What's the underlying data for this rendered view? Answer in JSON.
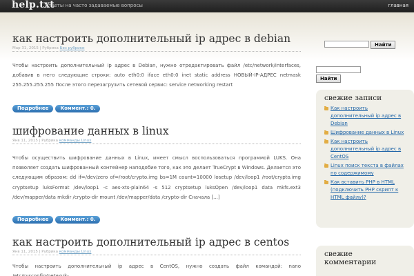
{
  "header": {
    "logo": "help.txt",
    "tagline": "ответы на часто задаваемые вопросы",
    "nav_home": "главная"
  },
  "posts": [
    {
      "title": "как настроить дополнительный ip адрес в debian",
      "date": "Мар 31, 2015",
      "sep": " | Рубрика ",
      "category": "Без рубрики",
      "body": "Чтобы настроить дополнительный ip адрес в Debian, нужно отредактировать файл /etc/network/interfaces, добавив в него следующие строки: auto eth0:0 iface eth0:0 inet static address НОВЫЙ-IP-АДРЕС netmask 255.255.255.255 После этого перезагрузить сетевой сервис: service networking restart",
      "more_label": "Подробнее",
      "comments_label": "Коммент.: 0."
    },
    {
      "title": "шифрование данных в linux",
      "date": "Янв 11, 2015",
      "sep": " | Рубрика ",
      "category": "комманды Linux",
      "body": "Чтобы осуществить шифрование данных в Linux, имеет смысл воспользоваться программой LUKS. Она позволяет создать шифрованный контейнер наподобие того, как это делает TrueCrypt в Windows. Делается это следующим образом: dd if=/dev/zero of=/root/crypto.img bs=1M count=10000 losetup /dev/loop1 /root/crypto.img cryptsetup luksFormat /dev/loop1 -c aes-xts-plain64 -s 512 cryptsetup luksOpen /dev/loop1 data mkfs.ext3 /dev/mapper/data mkdir /crypto-dir mount /dev/mapper/data /crypto-dir Сначала [...]",
      "more_label": "Подробнее",
      "comments_label": "Коммент.: 0."
    },
    {
      "title": "как настроить дополнительный ip адрес в centos",
      "date": "Янв 11, 2015",
      "sep": " | Рубрика ",
      "category": "комманды Linux",
      "body": "Чтобы настроить дополнительный ip адрес в CentOS, нужно создать файл командой: nano /etc/sysconfig/network-"
    }
  ],
  "sidebar": {
    "search_button": "Найти",
    "recent_title": "свежие записи",
    "recent_items": [
      "Как настроить дополнительный ip адрес в Debian",
      "Шифрование данных в Linux",
      "Как настроить дополнительный ip адрес в CentOS",
      "Linux поиск текста в файлах по содержимому",
      "Как вставить PHP в HTML (подключить PHP скрипт к HTML файлу)?"
    ],
    "comments_title": "свежие комментарии"
  },
  "icons": {
    "list_bullet": "folder-icon"
  },
  "colors": {
    "button_blue": "#2c6fb0",
    "link_blue": "#2166a8",
    "header_dark": "#2a2a2a",
    "widget_bg": "#f0efe8"
  }
}
